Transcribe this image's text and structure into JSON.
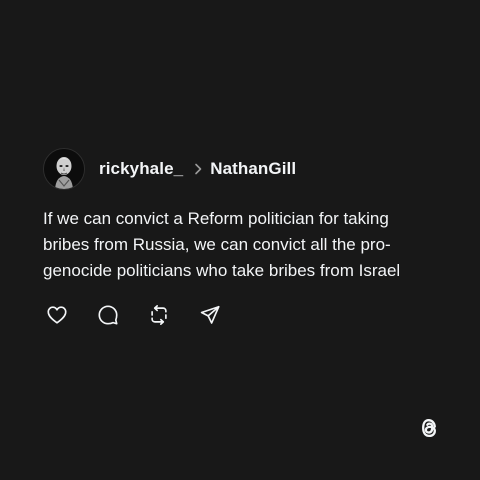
{
  "post": {
    "author": "rickyhale_",
    "reply_to": "NathanGill",
    "text_lines": [
      "If we can convict a Reform politician for taking",
      "bribes from Russia, we can convict all the pro-",
      "genocide politicians who take bribes from Israel"
    ],
    "avatar_icon": "portrait-avatar",
    "separator_icon": "chevron-right-icon"
  },
  "actions": [
    {
      "name": "like",
      "icon": "heart-icon"
    },
    {
      "name": "reply",
      "icon": "comment-icon"
    },
    {
      "name": "repost",
      "icon": "repost-icon"
    },
    {
      "name": "share",
      "icon": "send-icon"
    }
  ],
  "brand": {
    "icon": "threads-logo-icon"
  },
  "colors": {
    "background": "#181818",
    "text": "#f3f5f7",
    "icon": "#f3f5f7",
    "muted": "#9a9a9a"
  }
}
